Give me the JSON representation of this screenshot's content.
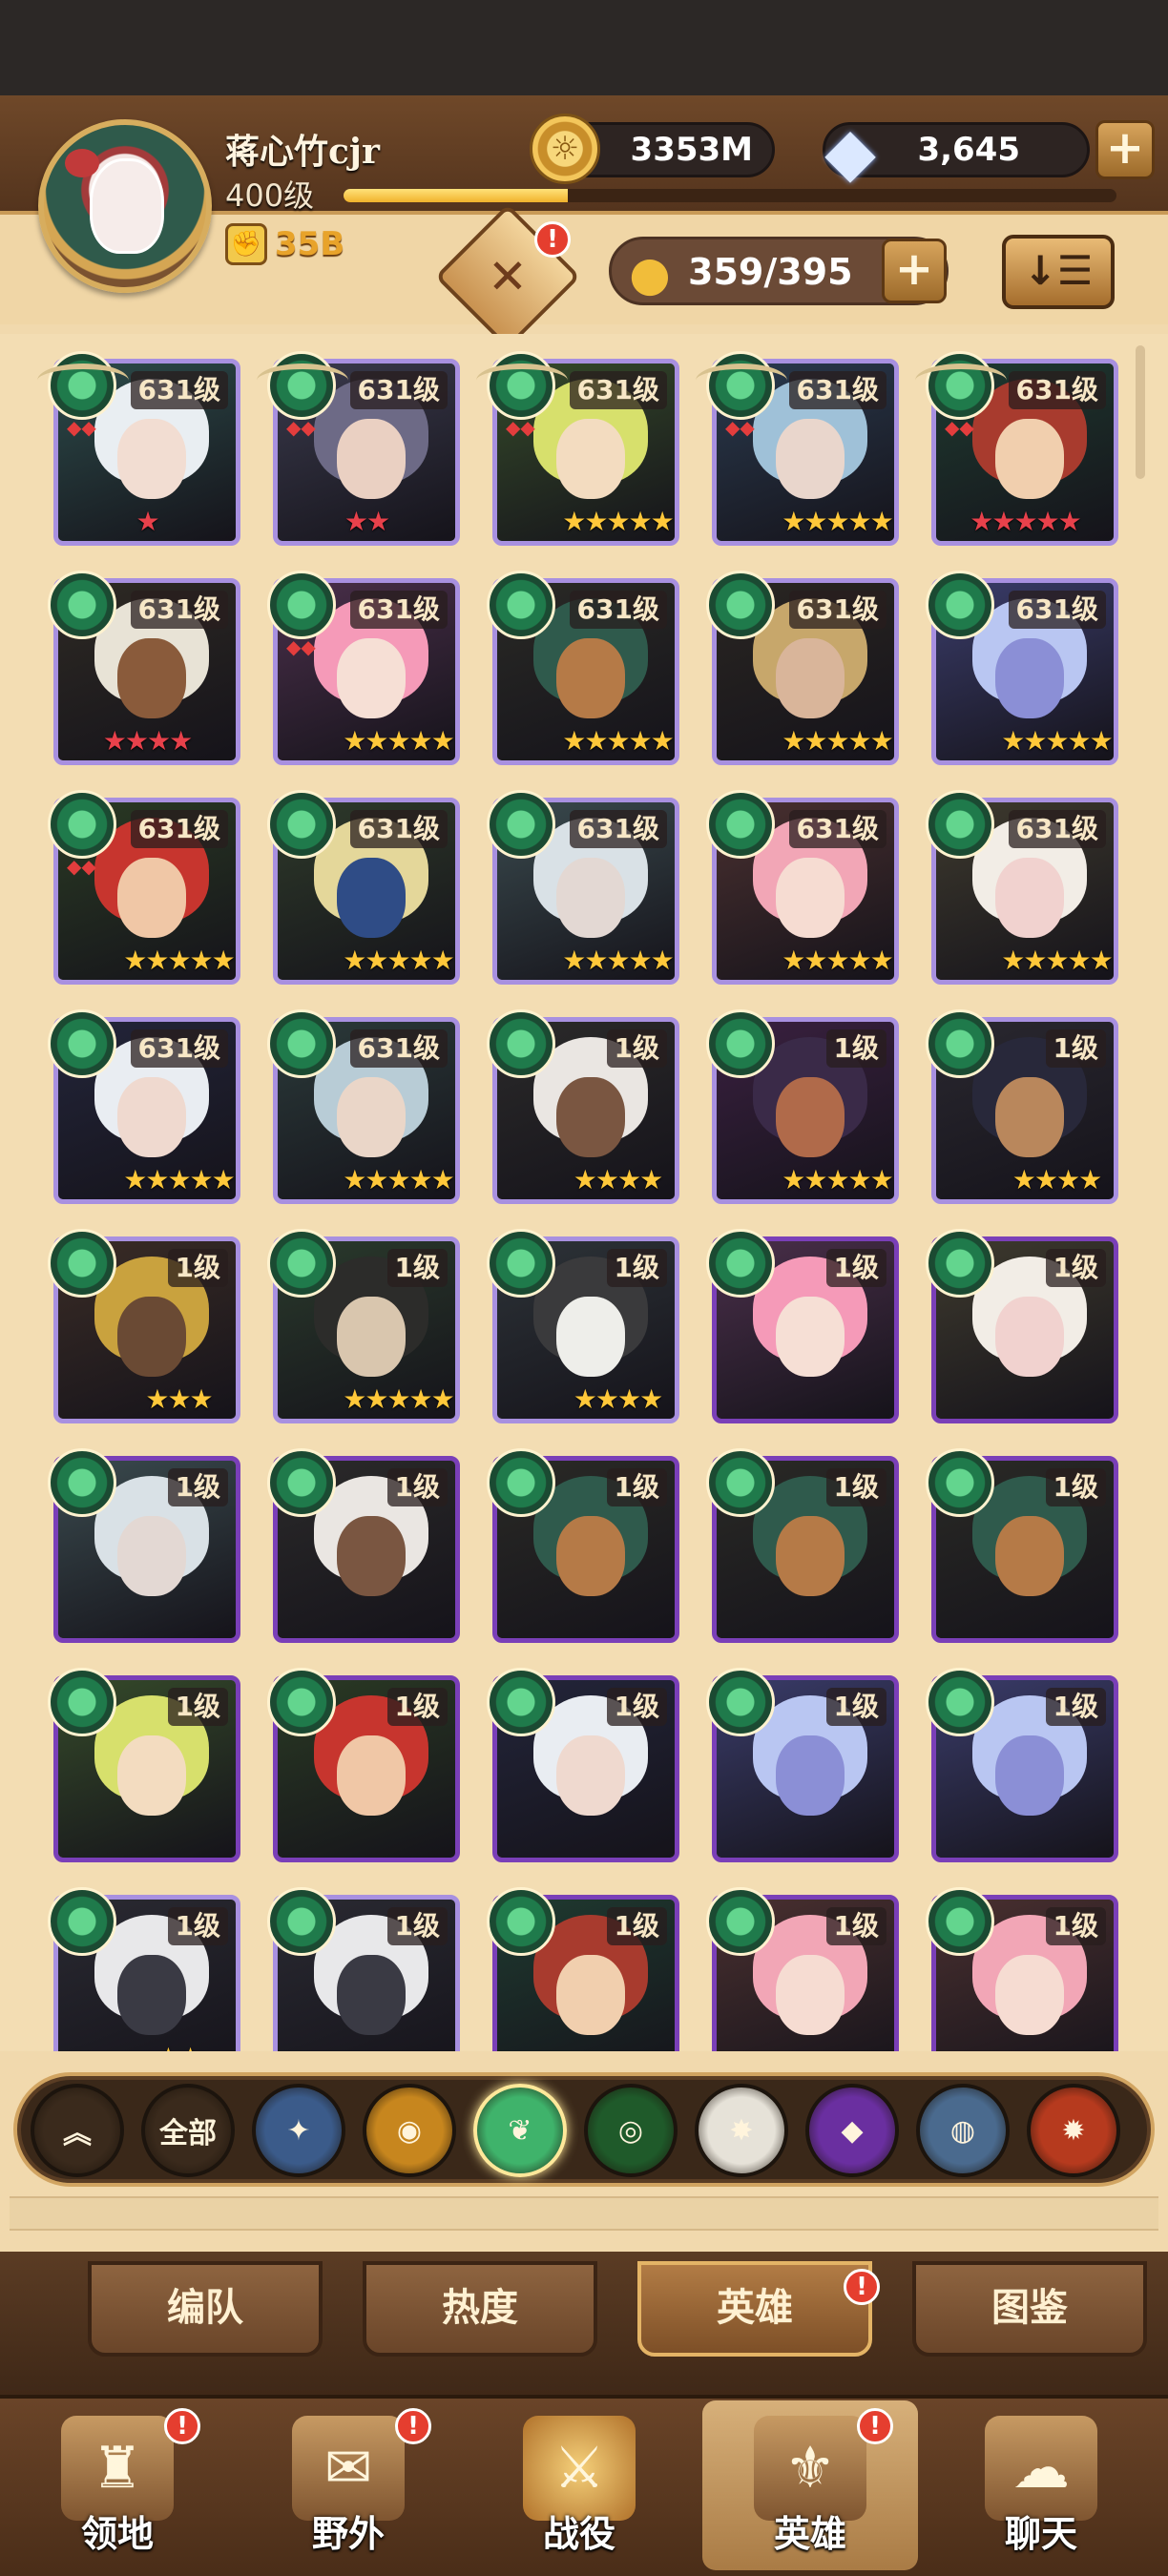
{
  "player": {
    "name": "蒋心竹cjr",
    "level": "400级",
    "xp_progress": 0.29,
    "power": "35B"
  },
  "currencies": {
    "gold": "3353M",
    "gems": "3,645"
  },
  "roster": {
    "capacity": "359/395"
  },
  "heroes": [
    {
      "level": "631级",
      "stars": "★",
      "star_color": "red",
      "hair": "#e9eef2",
      "skin": "#f2ddd2",
      "bg": "#2c4b4a",
      "winged": true,
      "marks": "◆◆"
    },
    {
      "level": "631级",
      "stars": "★★",
      "star_color": "red",
      "hair": "#6d6a86",
      "skin": "#ead0c2",
      "bg": "#3a3a4c",
      "winged": true,
      "marks": "◆◆"
    },
    {
      "level": "631级",
      "stars": "★★★★★",
      "star_color": "gold",
      "hair": "#d7e06c",
      "skin": "#f3dcc0",
      "bg": "#354a2a",
      "winged": true,
      "marks": "◆◆"
    },
    {
      "level": "631级",
      "stars": "★★★★★",
      "star_color": "gold",
      "hair": "#9fc1d8",
      "skin": "#e9d6cc",
      "bg": "#2a3a4e",
      "winged": true,
      "marks": "◆◆"
    },
    {
      "level": "631级",
      "stars": "★★★★★",
      "star_color": "red",
      "hair": "#a83b2e",
      "skin": "#f1cfae",
      "bg": "#1f3a30",
      "winged": true,
      "marks": "◆◆"
    },
    {
      "level": "631级",
      "stars": "★★★★",
      "star_color": "red",
      "hair": "#e8e3d6",
      "skin": "#8a5b3b",
      "bg": "#2e2a24",
      "winged": false,
      "marks": ""
    },
    {
      "level": "631级",
      "stars": "★★★★★",
      "star_color": "gold",
      "hair": "#f59ab8",
      "skin": "#f6dfd5",
      "bg": "#4a2f4a",
      "winged": false,
      "marks": "◆◆"
    },
    {
      "level": "631级",
      "stars": "★★★★★",
      "star_color": "gold",
      "hair": "#2f5a4c",
      "skin": "#b57a47",
      "bg": "#2a2a26",
      "winged": false,
      "marks": ""
    },
    {
      "level": "631级",
      "stars": "★★★★★",
      "star_color": "gold",
      "hair": "#c7a76b",
      "skin": "#d9b59a",
      "bg": "#2a2622",
      "winged": false,
      "marks": ""
    },
    {
      "level": "631级",
      "stars": "★★★★★",
      "star_color": "gold",
      "hair": "#b9c6f2",
      "skin": "#8b8fd6",
      "bg": "#3a3c6a",
      "winged": false,
      "marks": ""
    },
    {
      "level": "631级",
      "stars": "★★★★★",
      "star_color": "gold",
      "hair": "#c7352e",
      "skin": "#f0c7a6",
      "bg": "#2a3a24",
      "winged": false,
      "marks": "◆◆"
    },
    {
      "level": "631级",
      "stars": "★★★★★",
      "star_color": "gold",
      "hair": "#e4d79a",
      "skin": "#2f4c86",
      "bg": "#2e3a2a",
      "winged": false,
      "marks": ""
    },
    {
      "level": "631级",
      "stars": "★★★★★",
      "star_color": "gold",
      "hair": "#d9e1e6",
      "skin": "#e3d8d3",
      "bg": "#3a4a4e",
      "winged": false,
      "marks": ""
    },
    {
      "level": "631级",
      "stars": "★★★★★",
      "star_color": "gold",
      "hair": "#f2a6b6",
      "skin": "#f6dcd2",
      "bg": "#4a3030",
      "winged": false,
      "marks": ""
    },
    {
      "level": "631级",
      "stars": "★★★★★",
      "star_color": "gold",
      "hair": "#f2ede6",
      "skin": "#f1d2cf",
      "bg": "#3e3a2e",
      "winged": false,
      "marks": ""
    },
    {
      "level": "631级",
      "stars": "★★★★★",
      "star_color": "gold",
      "hair": "#e9edf2",
      "skin": "#efd9cf",
      "bg": "#23253a",
      "winged": false,
      "marks": ""
    },
    {
      "level": "631级",
      "stars": "★★★★★",
      "star_color": "gold",
      "hair": "#b8ccd6",
      "skin": "#ead6c8",
      "bg": "#2b3a3a",
      "winged": false,
      "marks": ""
    },
    {
      "level": "1级",
      "stars": "★★★★",
      "star_color": "gold",
      "hair": "#eae6e2",
      "skin": "#7a5641",
      "bg": "#2b2a2a",
      "winged": false,
      "marks": ""
    },
    {
      "level": "1级",
      "stars": "★★★★★",
      "star_color": "gold",
      "hair": "#3a2a48",
      "skin": "#b06a4a",
      "bg": "#3a2040",
      "winged": false,
      "marks": ""
    },
    {
      "level": "1级",
      "stars": "★★★★",
      "star_color": "gold",
      "hair": "#28283a",
      "skin": "#b9875c",
      "bg": "#2a2830",
      "winged": false,
      "marks": ""
    },
    {
      "level": "1级",
      "stars": "★★★",
      "star_color": "gold",
      "hair": "#c9a23e",
      "skin": "#6a4a34",
      "bg": "#3a2c26",
      "winged": false,
      "marks": ""
    },
    {
      "level": "1级",
      "stars": "★★★★★",
      "star_color": "gold",
      "hair": "#2c2c2a",
      "skin": "#d9c6ae",
      "bg": "#2a3a2c",
      "winged": false,
      "marks": ""
    },
    {
      "level": "1级",
      "stars": "★★★★",
      "star_color": "gold",
      "hair": "#3a3a3c",
      "skin": "#eeeeea",
      "bg": "#2d3338",
      "winged": false,
      "marks": ""
    },
    {
      "level": "1级",
      "stars": "",
      "star_color": "gold",
      "hair": "#f59ab8",
      "skin": "#f6dfd5",
      "bg": "#4a2f4a",
      "winged": false,
      "marks": "",
      "dark": true
    },
    {
      "level": "1级",
      "stars": "",
      "star_color": "gold",
      "hair": "#f2ede6",
      "skin": "#f1d2cf",
      "bg": "#3e3a2e",
      "winged": false,
      "marks": "",
      "dark": true
    },
    {
      "level": "1级",
      "stars": "",
      "star_color": "gold",
      "hair": "#d9e1e6",
      "skin": "#e3d8d3",
      "bg": "#3a4a4e",
      "winged": false,
      "marks": "",
      "dark": true
    },
    {
      "level": "1级",
      "stars": "",
      "star_color": "gold",
      "hair": "#eae6e2",
      "skin": "#7a5641",
      "bg": "#2b2a2a",
      "winged": false,
      "marks": "",
      "dark": true
    },
    {
      "level": "1级",
      "stars": "",
      "star_color": "gold",
      "hair": "#2f5a4c",
      "skin": "#b57a47",
      "bg": "#2a2a26",
      "winged": false,
      "marks": "",
      "dark": true
    },
    {
      "level": "1级",
      "stars": "",
      "star_color": "gold",
      "hair": "#2f5a4c",
      "skin": "#b57a47",
      "bg": "#2a2a26",
      "winged": false,
      "marks": "",
      "dark": true
    },
    {
      "level": "1级",
      "stars": "",
      "star_color": "gold",
      "hair": "#2f5a4c",
      "skin": "#b57a47",
      "bg": "#2a2a26",
      "winged": false,
      "marks": "",
      "dark": true
    },
    {
      "level": "1级",
      "stars": "",
      "star_color": "gold",
      "hair": "#d7e06c",
      "skin": "#f3dcc0",
      "bg": "#354a2a",
      "winged": false,
      "marks": "",
      "dark": true
    },
    {
      "level": "1级",
      "stars": "",
      "star_color": "gold",
      "hair": "#c7352e",
      "skin": "#f0c7a6",
      "bg": "#2a3a24",
      "winged": false,
      "marks": "",
      "dark": true
    },
    {
      "level": "1级",
      "stars": "",
      "star_color": "gold",
      "hair": "#e9edf2",
      "skin": "#efd9cf",
      "bg": "#23253a",
      "winged": false,
      "marks": "",
      "dark": true
    },
    {
      "level": "1级",
      "stars": "",
      "star_color": "gold",
      "hair": "#b9c6f2",
      "skin": "#8b8fd6",
      "bg": "#3a3c6a",
      "winged": false,
      "marks": "",
      "dark": true
    },
    {
      "level": "1级",
      "stars": "",
      "star_color": "gold",
      "hair": "#b9c6f2",
      "skin": "#8b8fd6",
      "bg": "#3a3c6a",
      "winged": false,
      "marks": "",
      "dark": true
    },
    {
      "level": "1级",
      "stars": "★★",
      "star_color": "gold",
      "hair": "#e8e8ea",
      "skin": "#3a3a44",
      "bg": "#2a2a32",
      "winged": false,
      "marks": ""
    },
    {
      "level": "1级",
      "stars": "",
      "star_color": "gold",
      "hair": "#e8e8ea",
      "skin": "#3a3a44",
      "bg": "#2a2a32",
      "winged": false,
      "marks": ""
    },
    {
      "level": "1级",
      "stars": "",
      "star_color": "gold",
      "hair": "#a83b2e",
      "skin": "#f1cfae",
      "bg": "#1f3a30",
      "winged": false,
      "marks": "",
      "dark": true
    },
    {
      "level": "1级",
      "stars": "",
      "star_color": "gold",
      "hair": "#f2a6b6",
      "skin": "#f6dcd2",
      "bg": "#4a3030",
      "winged": false,
      "marks": "",
      "dark": true
    },
    {
      "level": "1级",
      "stars": "",
      "star_color": "gold",
      "hair": "#f2a6b6",
      "skin": "#f6dcd2",
      "bg": "#4a3030",
      "winged": false,
      "marks": "",
      "dark": true
    }
  ],
  "filters": [
    {
      "name": "rank-filter-icon",
      "label": "",
      "symbol": "︽",
      "color": "#3a2a1c"
    },
    {
      "name": "all-filter",
      "label": "全部",
      "symbol": "",
      "color": "#3a2a1c"
    },
    {
      "name": "lightbearer-faction-icon",
      "label": "",
      "symbol": "✦",
      "color": "#3b5b8a"
    },
    {
      "name": "mauler-faction-icon",
      "label": "",
      "symbol": "◉",
      "color": "#c7861e"
    },
    {
      "name": "wilder-faction-icon",
      "label": "",
      "symbol": "❦",
      "color": "#3fb36b"
    },
    {
      "name": "graveborn-faction-icon",
      "label": "",
      "symbol": "◎",
      "color": "#1f5a2a"
    },
    {
      "name": "celestial-faction-icon",
      "label": "",
      "symbol": "✸",
      "color": "#e6e2d8"
    },
    {
      "name": "hypogean-faction-icon",
      "label": "",
      "symbol": "◆",
      "color": "#6a2fa0"
    },
    {
      "name": "dimensional-faction-icon",
      "label": "",
      "symbol": "◍",
      "color": "#4a6a8e"
    },
    {
      "name": "draconis-faction-icon",
      "label": "",
      "symbol": "✹",
      "color": "#b63a1e"
    }
  ],
  "subtabs": [
    "编队",
    "热度",
    "英雄",
    "图鉴"
  ],
  "nav": [
    {
      "label": "领地",
      "icon": "♜",
      "badge": "!"
    },
    {
      "label": "野外",
      "icon": "✉",
      "badge": "!"
    },
    {
      "label": "战役",
      "icon": "⚔",
      "badge": ""
    },
    {
      "label": "英雄",
      "icon": "⚜",
      "badge": "!"
    },
    {
      "label": "聊天",
      "icon": "☁",
      "badge": ""
    }
  ],
  "badges": {
    "formation": "!",
    "heroes_tab": "!"
  },
  "icons": {
    "coin": "☼",
    "diamond": "◆",
    "person": "👤",
    "sort": "↓☰",
    "plus": "+",
    "formation": "✕",
    "fist": "✊"
  }
}
